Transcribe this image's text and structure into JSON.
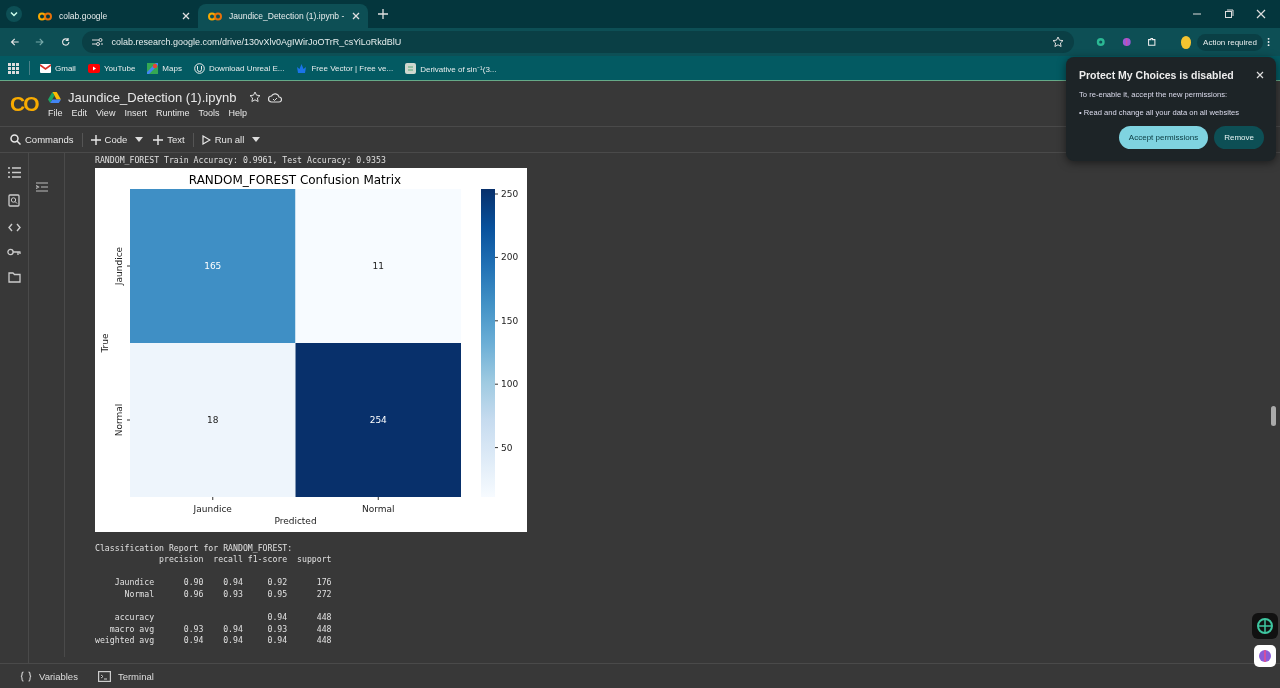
{
  "browser": {
    "tabs": [
      {
        "title": "colab.google",
        "selected": false
      },
      {
        "title": "Jaundice_Detection (1).ipynb -",
        "selected": true
      }
    ],
    "address": "colab.research.google.com/drive/130vXlv0AgIWirJoOTrR_csYiLoRkdBlU",
    "action_chip": "Action required",
    "bookmarks": [
      {
        "label": "Gmail",
        "kind": "mail"
      },
      {
        "label": "YouTube",
        "kind": "video"
      },
      {
        "label": "Maps",
        "kind": "map"
      },
      {
        "label": "Download Unreal E...",
        "kind": "unreal"
      },
      {
        "label": "Free Vector | Free ve...",
        "kind": "vector"
      },
      {
        "label": "Derivative of sin⁻¹(3...",
        "kind": "page"
      }
    ]
  },
  "notebook": {
    "title": "Jaundice_Detection (1).ipynb",
    "logo": "CO",
    "menu": [
      "File",
      "Edit",
      "View",
      "Insert",
      "Runtime",
      "Tools",
      "Help"
    ],
    "toolbar": [
      {
        "label": "Commands",
        "kind": "search"
      },
      {
        "label": "Code",
        "kind": "add",
        "dropdown": true
      },
      {
        "label": "Text",
        "kind": "add",
        "dropdown": false
      },
      {
        "label": "Run all",
        "kind": "run",
        "dropdown": true
      }
    ],
    "output_line": "RANDOM_FOREST Train Accuracy: 0.9961, Test Accuracy: 0.9353",
    "confusion_matrix": {
      "title": "RANDOM_FOREST Confusion Matrix",
      "xlabel": "Predicted",
      "ylabel": "True",
      "x_labels": [
        "Jaundice",
        "Normal"
      ],
      "y_labels": [
        "Jaundice",
        "Normal"
      ],
      "cells": [
        [
          {
            "text": "165",
            "color": "#3f8fc5"
          },
          {
            "text": "11",
            "color": "#f7fbff"
          }
        ],
        [
          {
            "text": "18",
            "color": "#eef5fc"
          },
          {
            "text": "254",
            "color": "#08306b"
          }
        ]
      ],
      "colorbar_ticks": [
        "250",
        "200",
        "150",
        "100",
        "50"
      ]
    },
    "report": {
      "title": "Classification Report for RANDOM_FOREST:",
      "columns": [
        "precision",
        "recall",
        "f1-score",
        "support"
      ],
      "groups": [
        [
          {
            "label": "Jaundice",
            "values": [
              "0.90",
              "0.94",
              "0.92",
              "176"
            ]
          },
          {
            "label": "Normal",
            "values": [
              "0.96",
              "0.93",
              "0.95",
              "272"
            ]
          }
        ],
        [
          {
            "label": "accuracy",
            "values": [
              "0.94",
              "448"
            ]
          },
          {
            "label": "macro avg",
            "values": [
              "0.93",
              "0.94",
              "0.93",
              "448"
            ]
          },
          {
            "label": "weighted avg",
            "values": [
              "0.94",
              "0.94",
              "0.94",
              "448"
            ]
          }
        ]
      ]
    },
    "bottom_bar": [
      {
        "label": "Variables",
        "kind": "braces"
      },
      {
        "label": "Terminal",
        "kind": "terminal"
      }
    ]
  },
  "popup": {
    "title": "Protect My Choices is disabled",
    "text": "To re-enable it, accept the new permissions:",
    "bullet": "• Read and change all your data on all websites",
    "buttons": [
      {
        "label": "Accept permissions",
        "kind": "primary"
      },
      {
        "label": "Remove",
        "kind": "secondary"
      }
    ]
  }
}
